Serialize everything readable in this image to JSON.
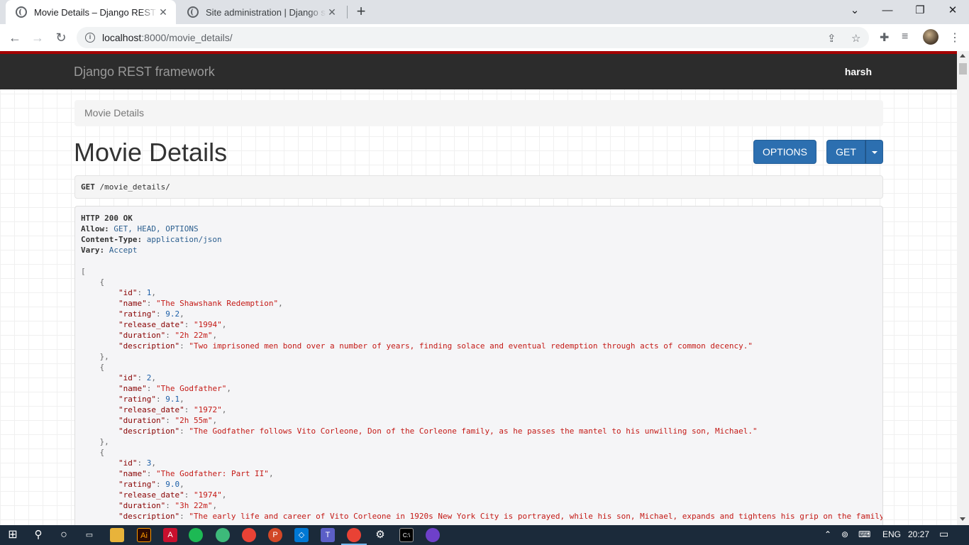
{
  "browser": {
    "tabs": [
      {
        "title": "Movie Details – Django REST framework",
        "active": true
      },
      {
        "title": "Site administration | Django site admin",
        "active": false
      }
    ],
    "url_host": "localhost",
    "url_path": ":8000/movie_details/"
  },
  "navbar": {
    "brand": "Django REST framework",
    "user": "harsh"
  },
  "breadcrumb": "Movie Details",
  "page_title": "Movie Details",
  "buttons": {
    "options": "OPTIONS",
    "get": "GET"
  },
  "request": {
    "method": "GET",
    "path": "/movie_details/"
  },
  "response": {
    "status": "HTTP 200 OK",
    "headers": [
      {
        "key": "Allow:",
        "value": "GET, HEAD, OPTIONS"
      },
      {
        "key": "Content-Type:",
        "value": "application/json"
      },
      {
        "key": "Vary:",
        "value": "Accept"
      }
    ],
    "movies": [
      {
        "id": "1",
        "name": "\"The Shawshank Redemption\"",
        "rating": "9.2",
        "release_date": "\"1994\"",
        "duration": "\"2h 22m\"",
        "description": "\"Two imprisoned men bond over a number of years, finding solace and eventual redemption through acts of common decency.\""
      },
      {
        "id": "2",
        "name": "\"The Godfather\"",
        "rating": "9.1",
        "release_date": "\"1972\"",
        "duration": "\"2h 55m\"",
        "description": "\"The Godfather follows Vito Corleone, Don of the Corleone family, as he passes the mantel to his unwilling son, Michael.\""
      },
      {
        "id": "3",
        "name": "\"The Godfather: Part II\"",
        "rating": "9.0",
        "release_date": "\"1974\"",
        "duration": "\"3h 22m\"",
        "description": "\"The early life and career of Vito Corleone in 1920s New York City is portrayed, while his son, Michael, expands and tightens his grip on the family"
      }
    ]
  },
  "taskbar": {
    "language": "ENG",
    "time": "20:27"
  }
}
